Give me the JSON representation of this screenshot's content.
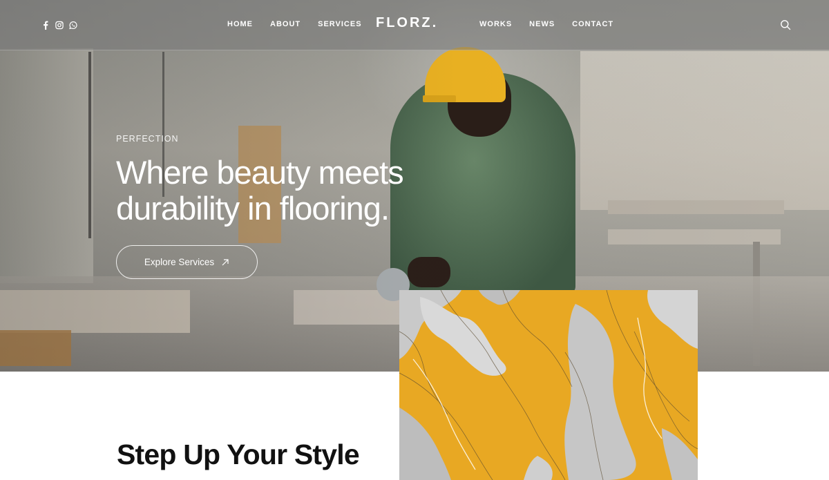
{
  "header": {
    "logo": "FLORZ.",
    "nav_left": [
      "HOME",
      "ABOUT",
      "SERVICES"
    ],
    "nav_right": [
      "WORKS",
      "NEWS",
      "CONTACT"
    ],
    "social_icons": [
      "facebook-icon",
      "instagram-icon",
      "whatsapp-icon"
    ],
    "search_icon": "search-icon"
  },
  "hero": {
    "eyebrow": "PERFECTION",
    "headline_line1": "Where beauty meets",
    "headline_line2": "durability in flooring.",
    "cta_label": "Explore Services",
    "cta_icon": "arrow-up-right-icon"
  },
  "section": {
    "title": "Step Up Your Style"
  },
  "colors": {
    "accent_yellow": "#e8a823",
    "text_dark": "#111111",
    "white": "#ffffff"
  }
}
